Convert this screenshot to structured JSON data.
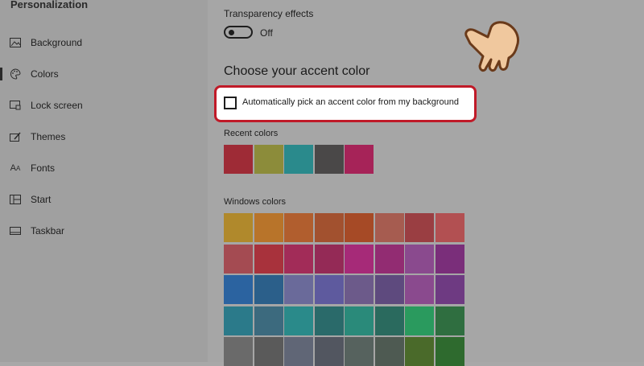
{
  "sidebar": {
    "title": "Personalization",
    "items": [
      {
        "label": "Background",
        "icon": "picture-icon",
        "selected": false
      },
      {
        "label": "Colors",
        "icon": "palette-icon",
        "selected": true
      },
      {
        "label": "Lock screen",
        "icon": "lock-screen-icon",
        "selected": false
      },
      {
        "label": "Themes",
        "icon": "brush-icon",
        "selected": false
      },
      {
        "label": "Fonts",
        "icon": "font-icon",
        "selected": false
      },
      {
        "label": "Start",
        "icon": "start-grid-icon",
        "selected": false
      },
      {
        "label": "Taskbar",
        "icon": "taskbar-icon",
        "selected": false
      }
    ]
  },
  "main": {
    "transparency_label": "Transparency effects",
    "transparency_state": "Off",
    "accent_heading": "Choose your accent color",
    "auto_pick_label": "Automatically pick an accent color from my background",
    "auto_pick_checked": false,
    "recent_label": "Recent colors",
    "recent_colors": [
      "#9e2b36",
      "#8c8c3a",
      "#2a8a8c",
      "#4a4848",
      "#a62358"
    ],
    "windows_label": "Windows colors",
    "windows_colors": [
      [
        "#b0892c",
        "#b8742a",
        "#b15e2e",
        "#a2512f",
        "#a64a26",
        "#a65c50",
        "#9a3e42",
        "#b25052"
      ],
      [
        "#a44b52",
        "#a8323c",
        "#a22c58",
        "#942a56",
        "#a62a78",
        "#922c72",
        "#8a4a8e",
        "#7a2e7a"
      ],
      [
        "#2b63a0",
        "#2b5f8a",
        "#6a6a9a",
        "#5e5a9e",
        "#6c5a8a",
        "#5e4a7e",
        "#8a4a8e",
        "#6e3a82"
      ],
      [
        "#2b7a8a",
        "#3c6a7e",
        "#2a8a8a",
        "#2a6a6a",
        "#2a8a7a",
        "#2a6a5e",
        "#2a9a5e",
        "#2f6e40"
      ],
      [
        "#6a6a6a",
        "#5a5a5a",
        "#606676",
        "#525660",
        "#56625e",
        "#4e5a52",
        "#4a6a2a",
        "#2e6a2e"
      ]
    ]
  },
  "accent": {
    "highlight": "#c01a28",
    "hand_skin": "#f0c89e"
  }
}
